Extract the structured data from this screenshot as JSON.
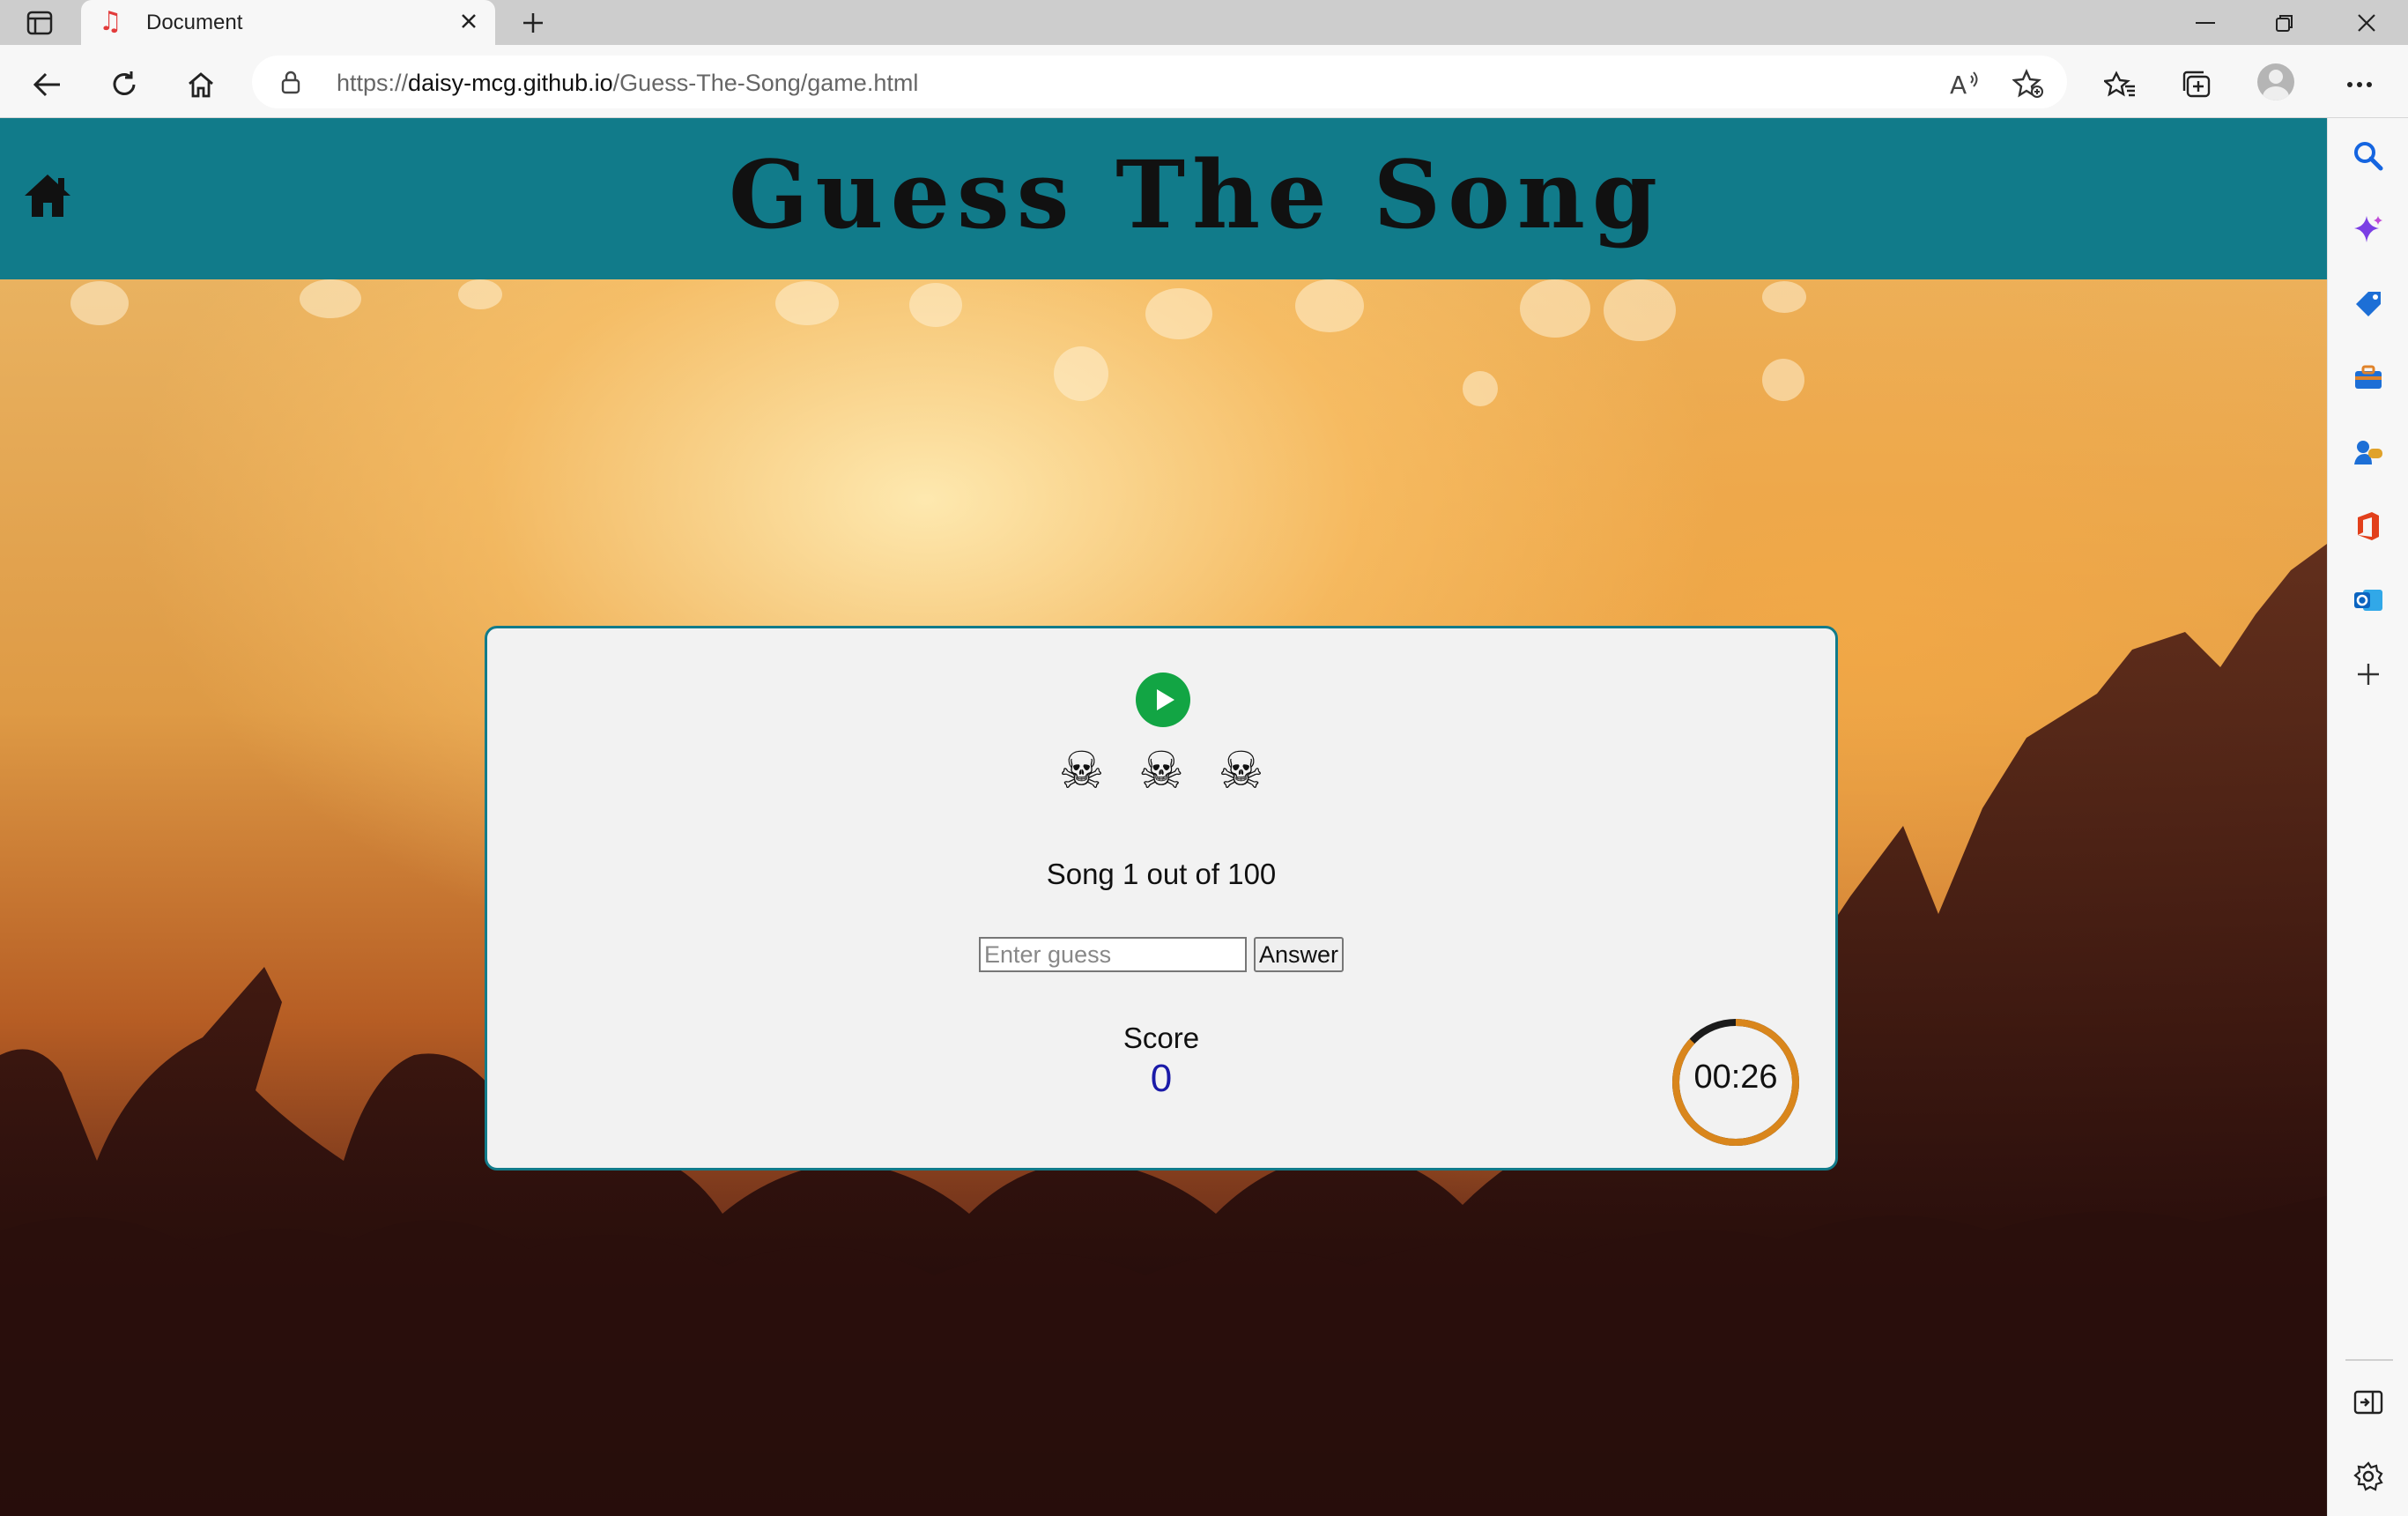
{
  "browser": {
    "tab_title": "Document",
    "url_prefix": "https://",
    "url_host": "daisy-mcg.github.io",
    "url_path": "/Guess-The-Song/game.html"
  },
  "page": {
    "title": "Guess The Song"
  },
  "game": {
    "lives": [
      "☠",
      "☠",
      "☠"
    ],
    "song_progress": "Song 1 out of 100",
    "guess_placeholder": "Enter guess",
    "guess_value": "",
    "answer_label": "Answer",
    "score_label": "Score",
    "score_value": "0",
    "timer_text": "00:26",
    "timer_remaining_fraction": 0.87
  },
  "colors": {
    "header_teal": "#117b8a",
    "play_green": "#12a544",
    "timer_orange": "#d9861c",
    "score_blue": "#1a1aa8"
  }
}
